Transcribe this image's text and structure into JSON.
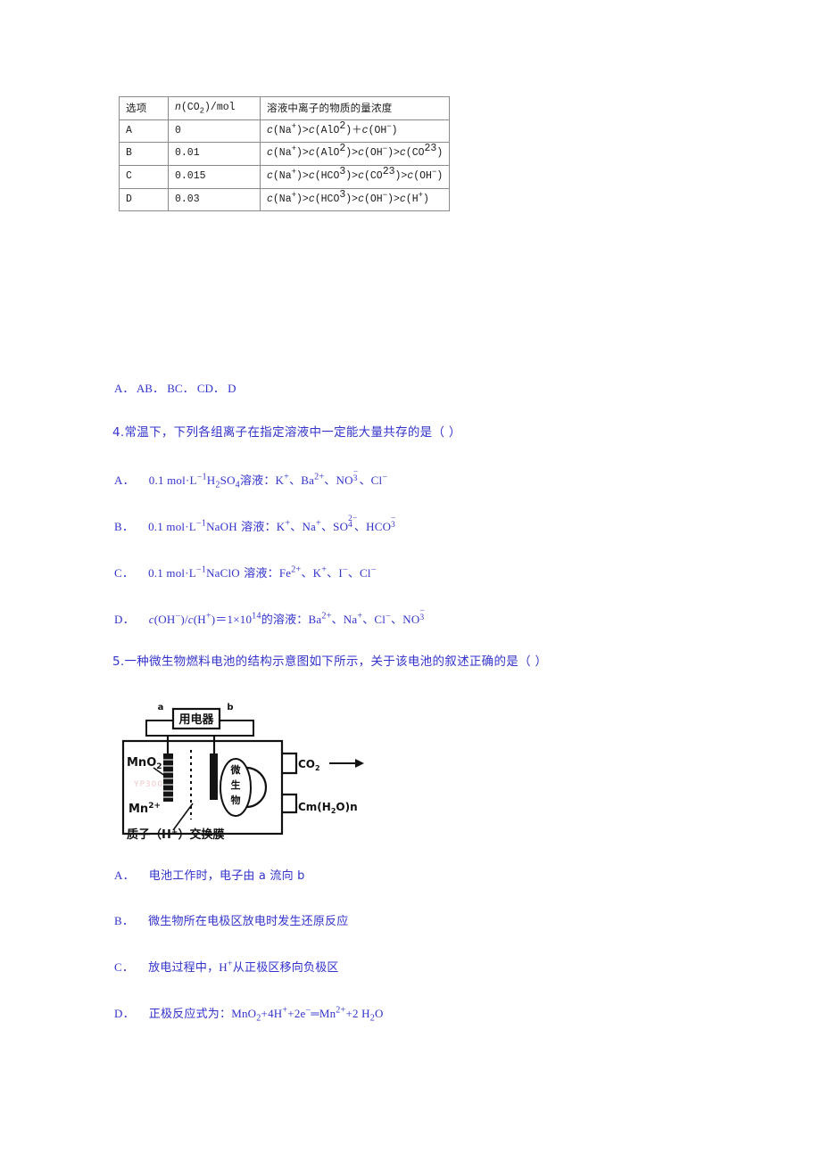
{
  "table": {
    "headers": [
      "选项",
      "n(CO₂)/mol",
      "溶液中离子的物质的量浓度"
    ],
    "rows": [
      {
        "option": "A",
        "n": "0",
        "conc": "c(Na+)>c(AlO2)+c(OH-)"
      },
      {
        "option": "B",
        "n": "0.01",
        "conc": "c(Na+)>c(AlO2)>c(OH-)>c(CO23)"
      },
      {
        "option": "C",
        "n": "0.015",
        "conc": "c(Na+)>c(HCO3)>c(CO23)>c(OH-)"
      },
      {
        "option": "D",
        "n": "0.03",
        "conc": "c(Na+)>c(HCO3)>c(OH-)>c(H+)"
      }
    ]
  },
  "answer_row": "A． AB． BC． CD． D",
  "q4": {
    "stem": "4.常温下，下列各组离子在指定溶液中一定能大量共存的是（     ）",
    "options": [
      {
        "label": "A．",
        "solution": "0.1 mol·L⁻¹H₂SO₄溶液：",
        "ions": "K⁺、Ba²⁺、NO₃⁻、Cl⁻"
      },
      {
        "label": "B．",
        "solution": "0.1 mol·L⁻¹NaOH 溶液：",
        "ions": "K⁺、Na⁺、SO₄²⁻、HCO₃⁻"
      },
      {
        "label": "C．",
        "solution": "0.1 mol·L⁻¹NaClO 溶液：",
        "ions": "Fe²⁺、K⁺、I⁻、Cl⁻"
      },
      {
        "label": "D．",
        "solution": "c(OH⁻)/c(H⁺)＝1×10¹⁴的溶液：",
        "ions": "Ba²⁺、Na⁺、Cl⁻、NO₃⁻"
      }
    ]
  },
  "q5": {
    "stem": "5.一种微生物燃料电池的结构示意图如下所示，关于该电池的叙述正确的是（     ）",
    "options": [
      {
        "label": "A．",
        "text": "电池工作时，电子由 a 流向 b"
      },
      {
        "label": "B．",
        "text": "微生物所在电极区放电时发生还原反应"
      },
      {
        "label": "C．",
        "text": "放电过程中，H⁺从正极区移向负极区"
      },
      {
        "label": "D．",
        "text": "正极反应式为：MnO₂+4H⁺+2e⁻═Mn²⁺+2 H₂O"
      }
    ]
  },
  "diagram": {
    "load_label": "用电器",
    "terminal_a": "a",
    "terminal_b": "b",
    "cathode_label": "MnO₂",
    "cathode_product": "Mn²⁺",
    "microbe_label": "微生物",
    "gas_out": "CO₂",
    "fuel_in": "Cm(H₂O)n",
    "membrane_label": "质子（H⁺）交换膜",
    "watermark": "YP300"
  },
  "colors": {
    "text_blue": "#3333cc",
    "table_border": "#8a8a8a",
    "ink": "#1a1a1a"
  }
}
